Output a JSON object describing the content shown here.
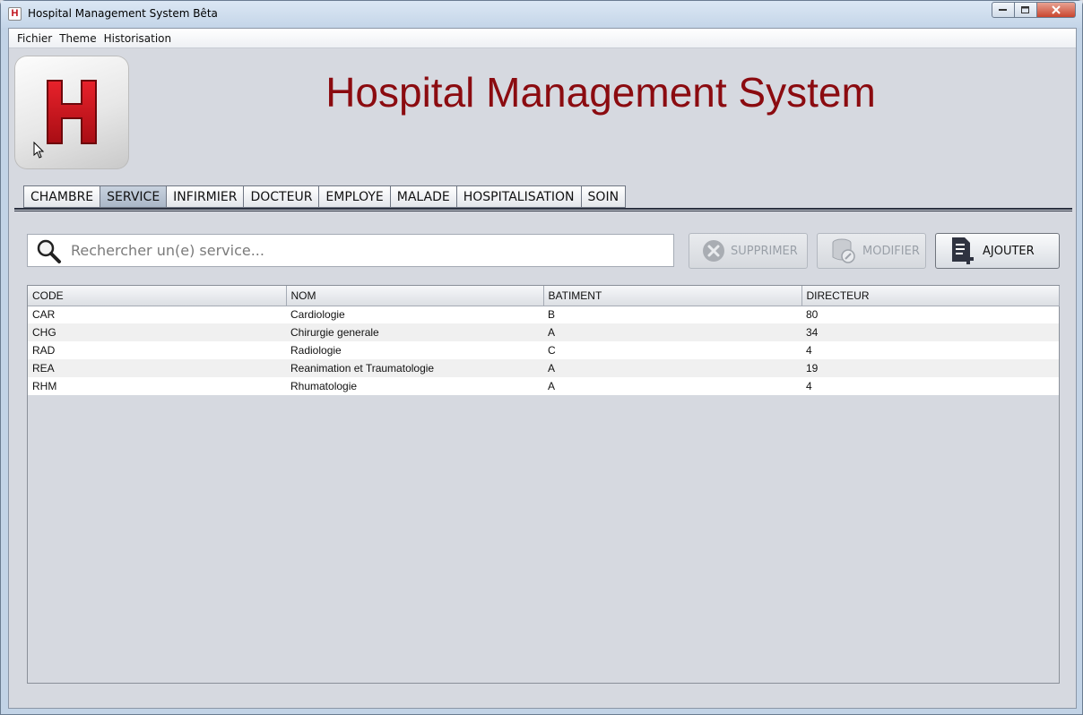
{
  "window": {
    "title": "Hospital Management System Bêta",
    "icon": "H"
  },
  "menu": [
    "Fichier",
    "Theme",
    "Historisation"
  ],
  "header": {
    "title": "Hospital Management System",
    "title_color": "#8b0b10"
  },
  "tabs": [
    "CHAMBRE",
    "SERVICE",
    "INFIRMIER",
    "DOCTEUR",
    "EMPLOYE",
    "MALADE",
    "HOSPITALISATION",
    "SOIN"
  ],
  "active_tab": "SERVICE",
  "search": {
    "placeholder": "Rechercher un(e) service..."
  },
  "actions": {
    "delete_label": "SUPPRIMER",
    "edit_label": "MODIFIER",
    "add_label": "AJOUTER"
  },
  "table": {
    "columns": [
      "CODE",
      "NOM",
      "BATIMENT",
      "DIRECTEUR"
    ],
    "rows": [
      [
        "CAR",
        "Cardiologie",
        "B",
        "80"
      ],
      [
        "CHG",
        "Chirurgie generale",
        "A",
        "34"
      ],
      [
        "RAD",
        "Radiologie",
        "C",
        "4"
      ],
      [
        "REA",
        "Reanimation et Traumatologie",
        "A",
        "19"
      ],
      [
        "RHM",
        "Rhumatologie",
        "A",
        "4"
      ]
    ]
  }
}
